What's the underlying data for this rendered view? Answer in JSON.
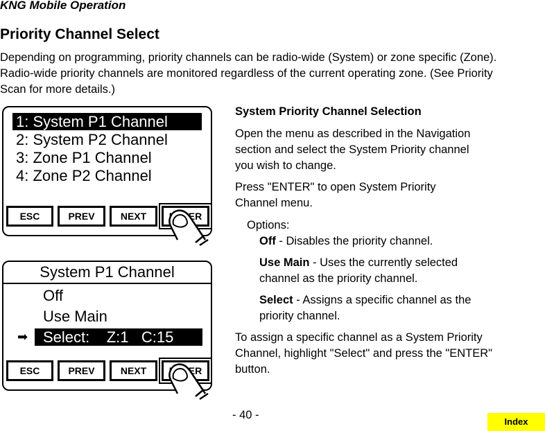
{
  "header": "KNG Mobile Operation",
  "title": "Priority Channel Select",
  "intro": "Depending on programming, priority channels can be radio-wide (System) or zone specific (Zone). Radio-wide priority channels are monitored regardless of the current operating zone. (See Priority Scan for more details.)",
  "screen1": {
    "items": [
      {
        "label": "1: System P1 Channel",
        "selected": true
      },
      {
        "label": "2: System P2 Channel",
        "selected": false
      },
      {
        "label": "3: Zone P1 Channel",
        "selected": false
      },
      {
        "label": "4: Zone P2 Channel",
        "selected": false
      }
    ]
  },
  "screen2": {
    "title": "System P1 Channel",
    "items": [
      {
        "label": "Off",
        "selected": false
      },
      {
        "label": "Use Main",
        "selected": false
      },
      {
        "label": "Select:    Z:1   C:15",
        "selected": true
      }
    ],
    "pointer_icon": "right-arrow-icon"
  },
  "softkeys": {
    "esc": "ESC",
    "prev": "PREV",
    "next": "NEXT",
    "enter": "ENTER"
  },
  "right": {
    "heading": "System Priority Channel Selection",
    "p1": "Open the menu as described in the Navigation section and select the System Priority channel you wish to change.",
    "p2": "Press \"ENTER\" to open System Priority Channel menu.",
    "options_label": "Options:",
    "options": [
      {
        "name": "Off",
        "desc": " - Disables the priority channel."
      },
      {
        "name": "Use Main",
        "desc": " - Uses the currently selected channel as the priority channel."
      },
      {
        "name": "Select",
        "desc": " - Assigns a specific channel as the priority channel."
      }
    ],
    "p3": "To assign a specific channel as a System Priority Channel, highlight \"Select\" and press the \"ENTER\" button."
  },
  "footer": {
    "page": "- 40 -",
    "index_label": "Index",
    "index_color": "#ffff00"
  }
}
